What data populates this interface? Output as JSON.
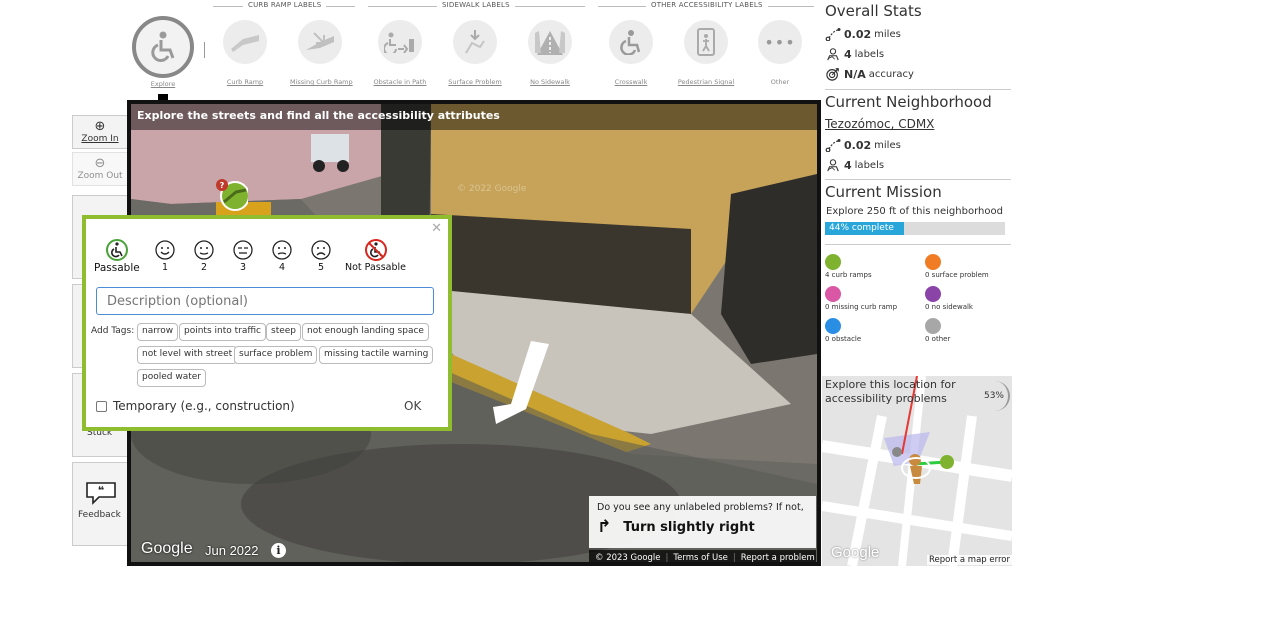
{
  "toolbar": {
    "groups": {
      "curb_ramp": "CURB RAMP LABELS",
      "sidewalk": "SIDEWALK LABELS",
      "other": "OTHER ACCESSIBILITY LABELS"
    },
    "tools": {
      "explore": "Explore",
      "curb_ramp": "Curb Ramp",
      "missing_curb_ramp": "Missing Curb Ramp",
      "obstacle": "Obstacle in Path",
      "surface_problem": "Surface Problem",
      "no_sidewalk": "No Sidewalk",
      "crosswalk": "Crosswalk",
      "pedestrian_signal": "Pedestrian Signal",
      "other": "Other"
    },
    "selected_tool": "explore"
  },
  "left_buttons": {
    "zoom_in": "Zoom In",
    "zoom_out": "Zoom Out",
    "stuck": "Stuck",
    "feedback": "Feedback"
  },
  "pano": {
    "title": "Explore the streets and find all the accessibility attributes",
    "watermark": "© 2022 Google",
    "google": "Google",
    "date": "Jun 2022",
    "nav_question": "Do you see any unlabeled problems? If not,",
    "nav_direction": "Turn slightly right",
    "footer": {
      "copyright": "© 2023 Google",
      "terms": "Terms of Use",
      "report": "Report a problem"
    }
  },
  "popup": {
    "severity": {
      "passable": "Passable",
      "s1": "1",
      "s2": "2",
      "s3": "3",
      "s4": "4",
      "s5": "5",
      "not_passable": "Not Passable"
    },
    "description_placeholder": "Description (optional)",
    "tags_label": "Add Tags:",
    "tags": [
      "narrow",
      "points into traffic",
      "steep",
      "not enough landing space",
      "not level with street",
      "surface problem",
      "missing tactile warning",
      "pooled water"
    ],
    "temporary_label": "Temporary (e.g., construction)",
    "ok": "OK"
  },
  "stats": {
    "overall_title": "Overall Stats",
    "overall_miles": "0.02",
    "overall_labels": "4",
    "overall_accuracy": "N/A",
    "miles_unit": "miles",
    "labels_unit": "labels",
    "accuracy_unit": "accuracy",
    "neighborhood_title": "Current Neighborhood",
    "neighborhood_name": "Tezozómoc, CDMX",
    "neighborhood_miles": "0.02",
    "neighborhood_labels": "4",
    "mission_title": "Current Mission",
    "mission_text": "Explore 250 ft of this neighborhood",
    "mission_progress": 44,
    "mission_progress_label": "44% complete"
  },
  "legend": {
    "curb_ramps": "4 curb ramps",
    "surface_problem": "0 surface problem",
    "missing_curb_ramp": "0 missing curb ramp",
    "no_sidewalk": "0 no sidewalk",
    "obstacle": "0 obstacle",
    "other": "0 other",
    "colors": {
      "curb_ramp": "#7fb32f",
      "surface_problem": "#f07d26",
      "missing_curb_ramp": "#d957a4",
      "no_sidewalk": "#8a44a8",
      "obstacle": "#2b8ee5",
      "other": "#a7a7a7"
    }
  },
  "minimap": {
    "message": "Explore this location for accessibility problems",
    "percent": "53%",
    "google": "Google",
    "report": "Report a map error"
  },
  "colors": {
    "accent_green": "#8fbd2f",
    "progress_blue": "#29a6d9"
  }
}
